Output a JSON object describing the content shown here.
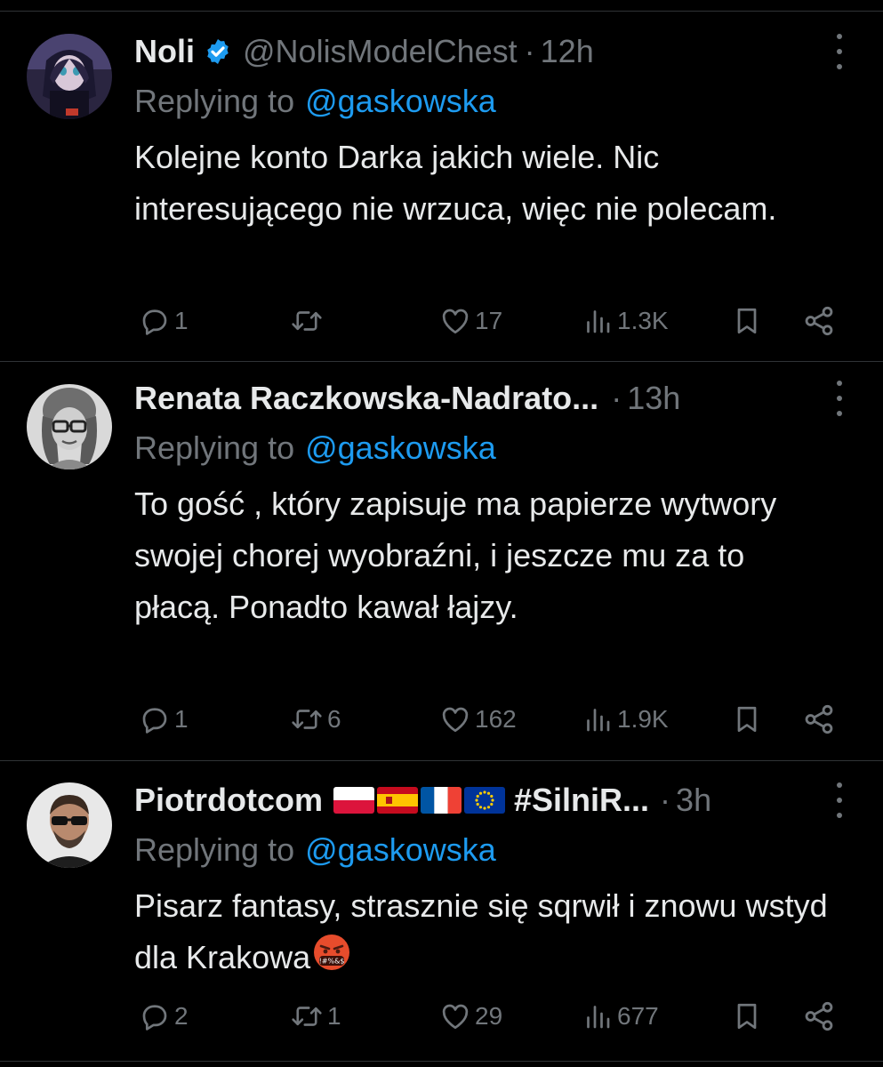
{
  "replies": [
    {
      "name": "Noli",
      "handle": "@NolisModelChest",
      "separator": "·",
      "time": "12h",
      "replying_label": "Replying to",
      "replying_handle": "@gaskowska",
      "text": "Kolejne konto Darka jakich wiele. Nic interesującego nie wrzuca, więc nie polecam.",
      "stats": {
        "replies": "1",
        "retweets": "",
        "likes": "17",
        "views": "1.3K"
      },
      "avatar_icon": "anime-avatar",
      "verified_icon": "verified-badge-icon"
    },
    {
      "name": "Renata Raczkowska-Nadrato...",
      "handle": "",
      "separator": "·",
      "time": "13h",
      "replying_label": "Replying to",
      "replying_handle": "@gaskowska",
      "text": "To gość , który zapisuje ma papierze wytwory swojej chorej wyobraźni, i jeszcze mu za to płacą. Ponadto kawał łajzy.",
      "stats": {
        "replies": "1",
        "retweets": "6",
        "likes": "162",
        "views": "1.9K"
      },
      "avatar_icon": "woman-with-glasses-avatar"
    },
    {
      "name": "Piotrdotcom",
      "name_suffix": "#SilniR...",
      "flags": [
        "poland-flag",
        "spain-flag",
        "france-flag",
        "eu-flag"
      ],
      "handle": "",
      "separator": "·",
      "time": "3h",
      "replying_label": "Replying to",
      "replying_handle": "@gaskowska",
      "text": "Pisarz fantasy, strasznie się sqrwił i znowu wstyd dla Krakowa",
      "text_emoji": "angry-face-with-symbols-emoji",
      "stats": {
        "replies": "2",
        "retweets": "1",
        "likes": "29",
        "views": "677"
      },
      "avatar_icon": "man-with-sunglasses-avatar"
    }
  ],
  "colors": {
    "background": "#000000",
    "text_primary": "#e7e9ea",
    "text_secondary": "#71767b",
    "link": "#1d9bf0",
    "divider": "#2f3336"
  },
  "icons": [
    "reply-icon",
    "retweet-icon",
    "like-icon",
    "views-icon",
    "bookmark-icon",
    "share-icon",
    "more-icon"
  ]
}
